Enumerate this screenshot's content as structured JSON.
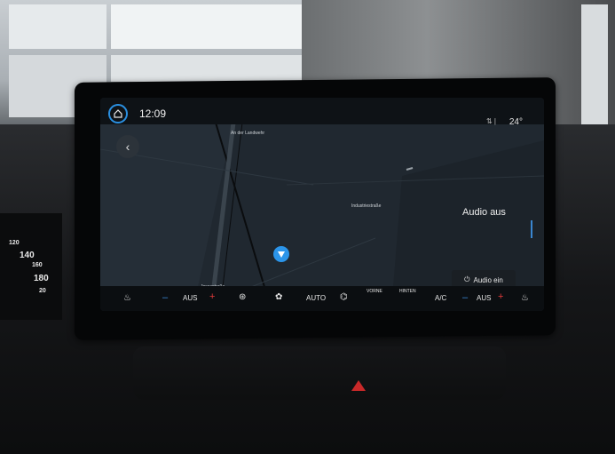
{
  "screen": {
    "time": "12:09",
    "signal_icon": "signal-icon",
    "temperature": "24°",
    "back_icon": "chevron-left-icon",
    "home_icon": "home-icon"
  },
  "map": {
    "streets": [
      "An der Landwehr",
      "Industriestraße",
      "Jossastraße"
    ],
    "location_icon": "navigation-arrow-icon"
  },
  "audio": {
    "status": "Audio aus",
    "button_label": "Audio ein",
    "button_icon": "power-icon"
  },
  "climate": {
    "left_minus": "–",
    "left_value": "AUS",
    "left_plus": "+",
    "auto_label": "AUTO",
    "front_label": "VORNE",
    "rear_label": "HINTEN",
    "ac_label": "A/C",
    "right_minus": "–",
    "right_value": "AUS",
    "right_plus": "+"
  },
  "cluster": {
    "speed_labels": [
      "120",
      "140",
      "160",
      "180",
      "20"
    ]
  },
  "colors": {
    "accent": "#2b95ea",
    "plus": "#e23a3a",
    "minus": "#3d8fe0"
  }
}
